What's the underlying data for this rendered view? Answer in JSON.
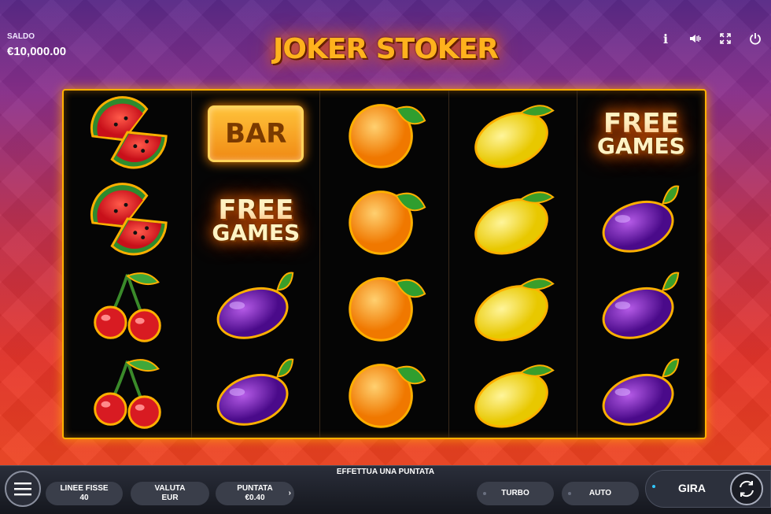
{
  "balance": {
    "label": "SALDO",
    "value": "€10,000.00"
  },
  "game": {
    "title": "JOKER STOKER"
  },
  "top_icons": [
    "info-icon",
    "sound-icon",
    "fullscreen-icon",
    "power-icon"
  ],
  "top_icon_labels": {
    "info": "i"
  },
  "reels": [
    [
      "watermelon",
      "watermelon",
      "cherry",
      "cherry"
    ],
    [
      "bar",
      "free-games",
      "plum",
      "plum"
    ],
    [
      "orange",
      "orange",
      "orange",
      "orange"
    ],
    [
      "lemon",
      "lemon",
      "lemon",
      "lemon"
    ],
    [
      "free-games",
      "plum",
      "plum",
      "plum"
    ]
  ],
  "symbol_text": {
    "bar": "BAR",
    "free": "FREE",
    "games": "GAMES"
  },
  "bottom": {
    "prompt": "EFFETTUA UNA PUNTATA",
    "lines": {
      "label": "LINEE FISSE",
      "value": "40"
    },
    "currency": {
      "label": "VALUTA",
      "value": "EUR"
    },
    "bet": {
      "label": "PUNTATA",
      "value": "€0.40"
    },
    "turbo": "TURBO",
    "auto": "AUTO",
    "spin": "GIRA"
  },
  "colors": {
    "frame": "#ffb000",
    "spin_dot": "#31c8ff"
  }
}
